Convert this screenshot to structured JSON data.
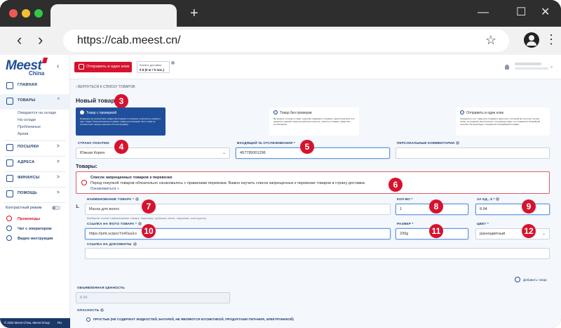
{
  "browser": {
    "url": "https://cab.meest.cn/",
    "new_tab": "+",
    "back": "‹",
    "forward": "›",
    "star": "☆",
    "minimize": "—",
    "maximize": "☐",
    "close": "✕",
    "menu": "⋮"
  },
  "sidebar": {
    "logo": "Meest",
    "logo_sub": "China",
    "items": [
      {
        "label": "ГЛАВНАЯ"
      },
      {
        "label": "ТОВАРЫ",
        "chev": "^"
      },
      {
        "label": "ПОСЫЛКИ",
        "chev": ">"
      },
      {
        "label": "АДРЕСА",
        "chev": ">"
      },
      {
        "label": "ФИНАНСЫ",
        "chev": ">"
      },
      {
        "label": "ПОМОЩЬ",
        "chev": ">"
      }
    ],
    "subitems": [
      "Ожидается на складе",
      "На складе",
      "Проблемные",
      "Архив"
    ],
    "contrast_mode": "Контрастный режим",
    "links": [
      {
        "label": "Промокоды"
      },
      {
        "label": "Чат с оператором"
      },
      {
        "label": "Видео инструкция"
      }
    ],
    "footer_copy": "© 2025 Meest China, Meest Group",
    "footer_lang": "RU"
  },
  "topbar": {
    "oneclick": "Отправить в один клик",
    "balance_label": "Баланс доставки",
    "balance_value": "0 $ (0 кг / 0 пос.)"
  },
  "page": {
    "back_link": "ВЕРНУТЬСЯ К СПИСКУ ТОВАРОВ",
    "title": "Новый товар",
    "types": [
      {
        "title": "Товар с проверкой",
        "desc": "Проверим на соответствие товара фотографии и описанию, количество, размер и цвет товара. Пришлём вам фотографии товара для проверки. Если товар не соответствует заказу, напишем об этом продавцу."
      },
      {
        "title": "Товар без проверки",
        "desc": "Вы можете отследить товар с другими товарами и отправить одной посылкой, или разделить данный товар на несколько посылок, отметить отправку товара без согласования."
      },
      {
        "title": "Отправить в один клик",
        "desc": "Определите этот товар для отправки в один клик, и который мы поступит на наш склад, он соединен на количество, на проверке будет ли отправлен в ближайшей посылке. Посылка будет отправлена в ближайший отправки."
      }
    ],
    "country_label": "СТРАНА ПОКУПКИ",
    "country_value": "Южная Корея",
    "tracking_label": "ВХОДЯЩИЙ № ОТСЛЕЖИВАНИЯ *",
    "tracking_value": "457795001296",
    "comment_label": "ПЕРСОНАЛЬНЫЕ КОММЕНТАРИИ",
    "goods_title": "Товары:",
    "alert": {
      "title": "Список запрещенных товаров к перевозке",
      "text": "Перед покупкой товаров обязательно ознакомьтесь с правилами перевозки. Важно изучить список запрещенных к перевозке товаров в страну доставки.",
      "link": "Ознакомиться »"
    },
    "row_number": "1.",
    "name_label": "НАИМЕНОВАНИЕ ТОВАРА *",
    "name_value": "Маска для волос",
    "name_hint": "Выберите точное наименование товара, например: рубашка, кепка, наушники, конструктор",
    "qty_label": "КОЛ-ВО *",
    "qty_value": "1",
    "price_label": "ЗА ЕД., $ *",
    "price_value": "8.94",
    "photo_label": "ССЫЛКА НА ФОТО ТОВАРА *",
    "photo_value": "https://pmt.sc/pocYs40ua1o",
    "size_label": "РАЗМЕР *",
    "size_value": "230g",
    "color_label": "ЦВЕТ *",
    "color_value": "разноцветный",
    "doc_label": "ССЫЛКА НА ДОКУМЕНТЫ",
    "add_item": "Добавить товар",
    "declared_label": "ОБЪЯВЛЕННАЯ ЦЕННОСТЬ",
    "declared_value": "8.94",
    "danger_label": "ОПАСНОСТЬ",
    "danger_option": "ПРОСТЫЕ (НЕ СОДЕРЖАТ ЖИДКОСТЕЙ, БАТАРЕЙ, НЕ ЯВЛЯЮТСЯ КОСМЕТИКОЙ, ПРОДУКТАМИ ПИТАНИЯ, ЭЛЕКТРОНИКОЙ)"
  },
  "badges": [
    "3",
    "4",
    "5",
    "6",
    "7",
    "8",
    "9",
    "10",
    "11",
    "12"
  ],
  "colors": {
    "accent": "#d5132e",
    "brand": "#1f4f9a"
  }
}
